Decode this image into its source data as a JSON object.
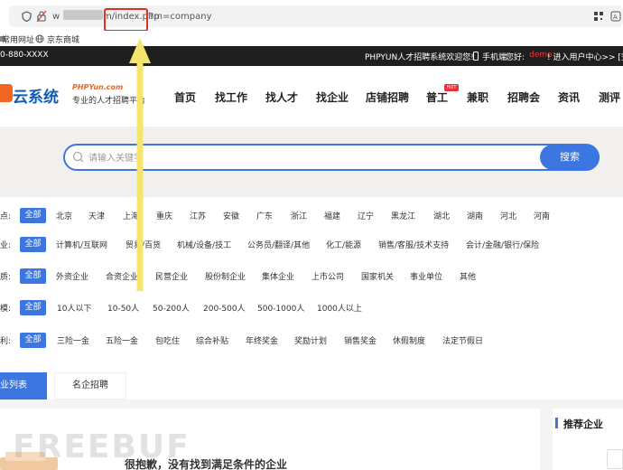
{
  "browser": {
    "url_prefix": "w",
    "url_highlight": "m/index.php",
    "url_suffix": "?m=company",
    "bookmarks": [
      "常用网址",
      "京东商城"
    ]
  },
  "topbar": {
    "phone": "0-880-XXXX",
    "welcome": "PHPYUN人才招聘系统欢迎您!",
    "mobile": "手机端",
    "hello": "您好:",
    "user": "demo",
    "user_center": "! 进入用户中心>> [安全"
  },
  "logo": {
    "main": "云系统",
    "sub1": "PHPYun.com",
    "sub2": "专业的人才招聘平台"
  },
  "nav": {
    "items": [
      "首页",
      "找工作",
      "找人才",
      "找企业",
      "店铺招聘",
      "普工",
      "兼职",
      "招聘会",
      "资讯",
      "测评"
    ],
    "hot_badge": "HOT"
  },
  "search": {
    "placeholder": "请输入关键字",
    "button": "搜索"
  },
  "filters": [
    {
      "label": "点:",
      "all": "全部",
      "options": [
        "北京",
        "天津",
        "上海",
        "重庆",
        "江苏",
        "安徽",
        "广东",
        "浙江",
        "福建",
        "辽宁",
        "黑龙江",
        "湖北",
        "湖南",
        "河北",
        "河南"
      ]
    },
    {
      "label": "业:",
      "all": "全部",
      "options": [
        "计算机/互联网",
        "贸易/百货",
        "机械/设备/技工",
        "公务员/翻译/其他",
        "化工/能源",
        "销售/客服/技术支持",
        "会计/金融/银行/保险"
      ]
    },
    {
      "label": "质:",
      "all": "全部",
      "options": [
        "外资企业",
        "合资企业",
        "民营企业",
        "股份制企业",
        "集体企业",
        "上市公司",
        "国家机关",
        "事业单位",
        "其他"
      ]
    },
    {
      "label": "模:",
      "all": "全部",
      "options": [
        "10人以下",
        "10-50人",
        "50-200人",
        "200-500人",
        "500-1000人",
        "1000人以上"
      ]
    },
    {
      "label": "利:",
      "all": "全部",
      "options": [
        "三险一金",
        "五险一金",
        "包吃住",
        "综合补贴",
        "年终奖金",
        "奖励计划",
        "销售奖金",
        "休假制度",
        "法定节假日"
      ]
    }
  ],
  "tabs": {
    "active": "业列表",
    "other": "名企招聘"
  },
  "content": {
    "empty_message": "很抱歉，没有找到满足条件的企业",
    "sidebar_title": "推荐企业",
    "watermark": "FREEBUF"
  },
  "colors": {
    "accent": "#3b76e1",
    "arrow": "#f5e66b",
    "highlight_box": "#e0301e",
    "logo_orange": "#f26522"
  }
}
